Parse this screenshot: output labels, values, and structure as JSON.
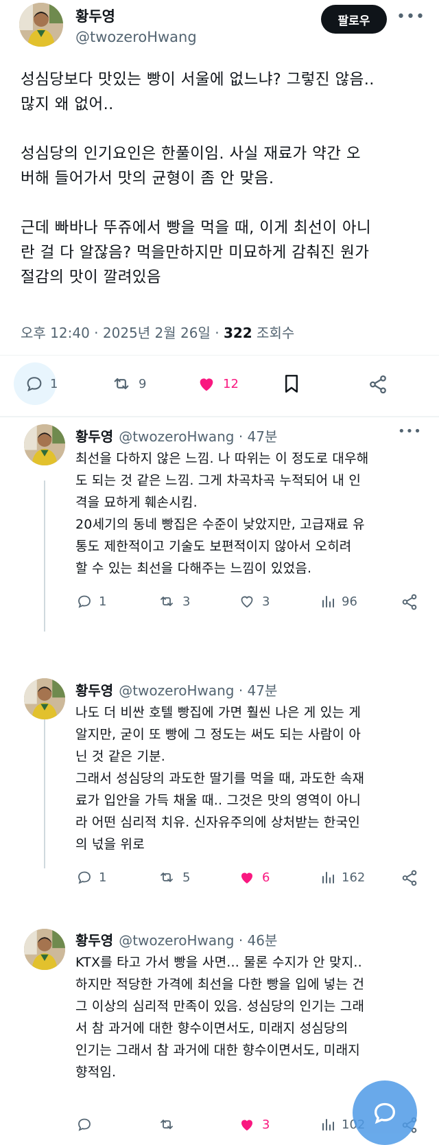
{
  "main_tweet": {
    "name": "황두영",
    "handle": "@twozeroHwang",
    "follow_label": "팔로우",
    "paragraphs": [
      [
        "성심당보다 맛있는 빵이 서울에 없느냐? 그렇진 않음..",
        "많지 왜 없어.."
      ],
      [
        "성심당의 인기요인은 한풀이임. 사실 재료가 약간 오",
        "버해 들어가서 맛의 균형이 좀 안 맞음."
      ],
      [
        "근데 빠바나 뚜쥬에서 빵을 먹을 때, 이게 최선이 아니",
        "란 걸 다 알잖음? 먹을만하지만 미묘하게 감춰진 원가",
        "절감의 맛이 깔려있음"
      ]
    ],
    "time": "오후 12:40 · 2025년 2월 26일 · ",
    "views_count": "322",
    "views_label": " 조회수",
    "stats": {
      "replies": "1",
      "retweets": "9",
      "likes": "12"
    }
  },
  "replies": [
    {
      "name": "황두영",
      "handle": "@twozeroHwang · 47분",
      "lines": [
        "최선을 다하지 않은 느낌. 나 따위는 이 정도로 대우해",
        "도 되는 것 같은 느낌.  그게 차곡차곡 누적되어 내 인",
        "격을 묘하게 훼손시킴.",
        "20세기의 동네 빵집은 수준이 낮았지만, 고급재료 유",
        "통도 제한적이고 기술도 보편적이지 않아서 오히려",
        "할 수 있는 최선을 다해주는 느낌이 있었음."
      ],
      "stats": {
        "replies": "1",
        "retweets": "3",
        "likes": "3",
        "views": "96"
      },
      "liked": false
    },
    {
      "name": "황두영",
      "handle": "@twozeroHwang · 47분",
      "lines": [
        "나도 더 비싼 호텔 빵집에 가면 훨씬 나은 게 있는 게",
        "알지만, 굳이 또 빵에 그 정도는 써도 되는 사람이 아",
        "닌 것 같은 기분.",
        "그래서 성심당의 과도한 딸기를 먹을 때, 과도한 속재",
        "료가 입안을 가득 채울 때.. 그것은 맛의 영역이 아니",
        "라 어떤 심리적 치유. 신자유주의에 상처받는 한국인",
        "의 넋을 위로"
      ],
      "stats": {
        "replies": "1",
        "retweets": "5",
        "likes": "6",
        "views": "162"
      },
      "liked": true
    },
    {
      "name": "황두영",
      "handle": "@twozeroHwang · 46분",
      "lines": [
        "KTX를 타고 가서 빵을 사면... 물론 수지가 안 맞지..",
        "하지만 적당한 가격에 최선을 다한 빵을 입에 넣는 건",
        "그 이상의 심리적 만족이 있음. 성심당의 인기는 그래",
        "서 참 과거에 대한 향수이면서도, 미래지  성심당의",
        "인기는 그래서 참 과거에 대한 향수이면서도, 미래지",
        "향적임."
      ],
      "stats": {
        "replies": "",
        "retweets": "",
        "likes": "3",
        "views": "102"
      },
      "liked": true
    }
  ],
  "colors": {
    "like": "#f91880",
    "text": "#0f1419",
    "muted": "#536471",
    "accent": "#1d9bf0"
  }
}
